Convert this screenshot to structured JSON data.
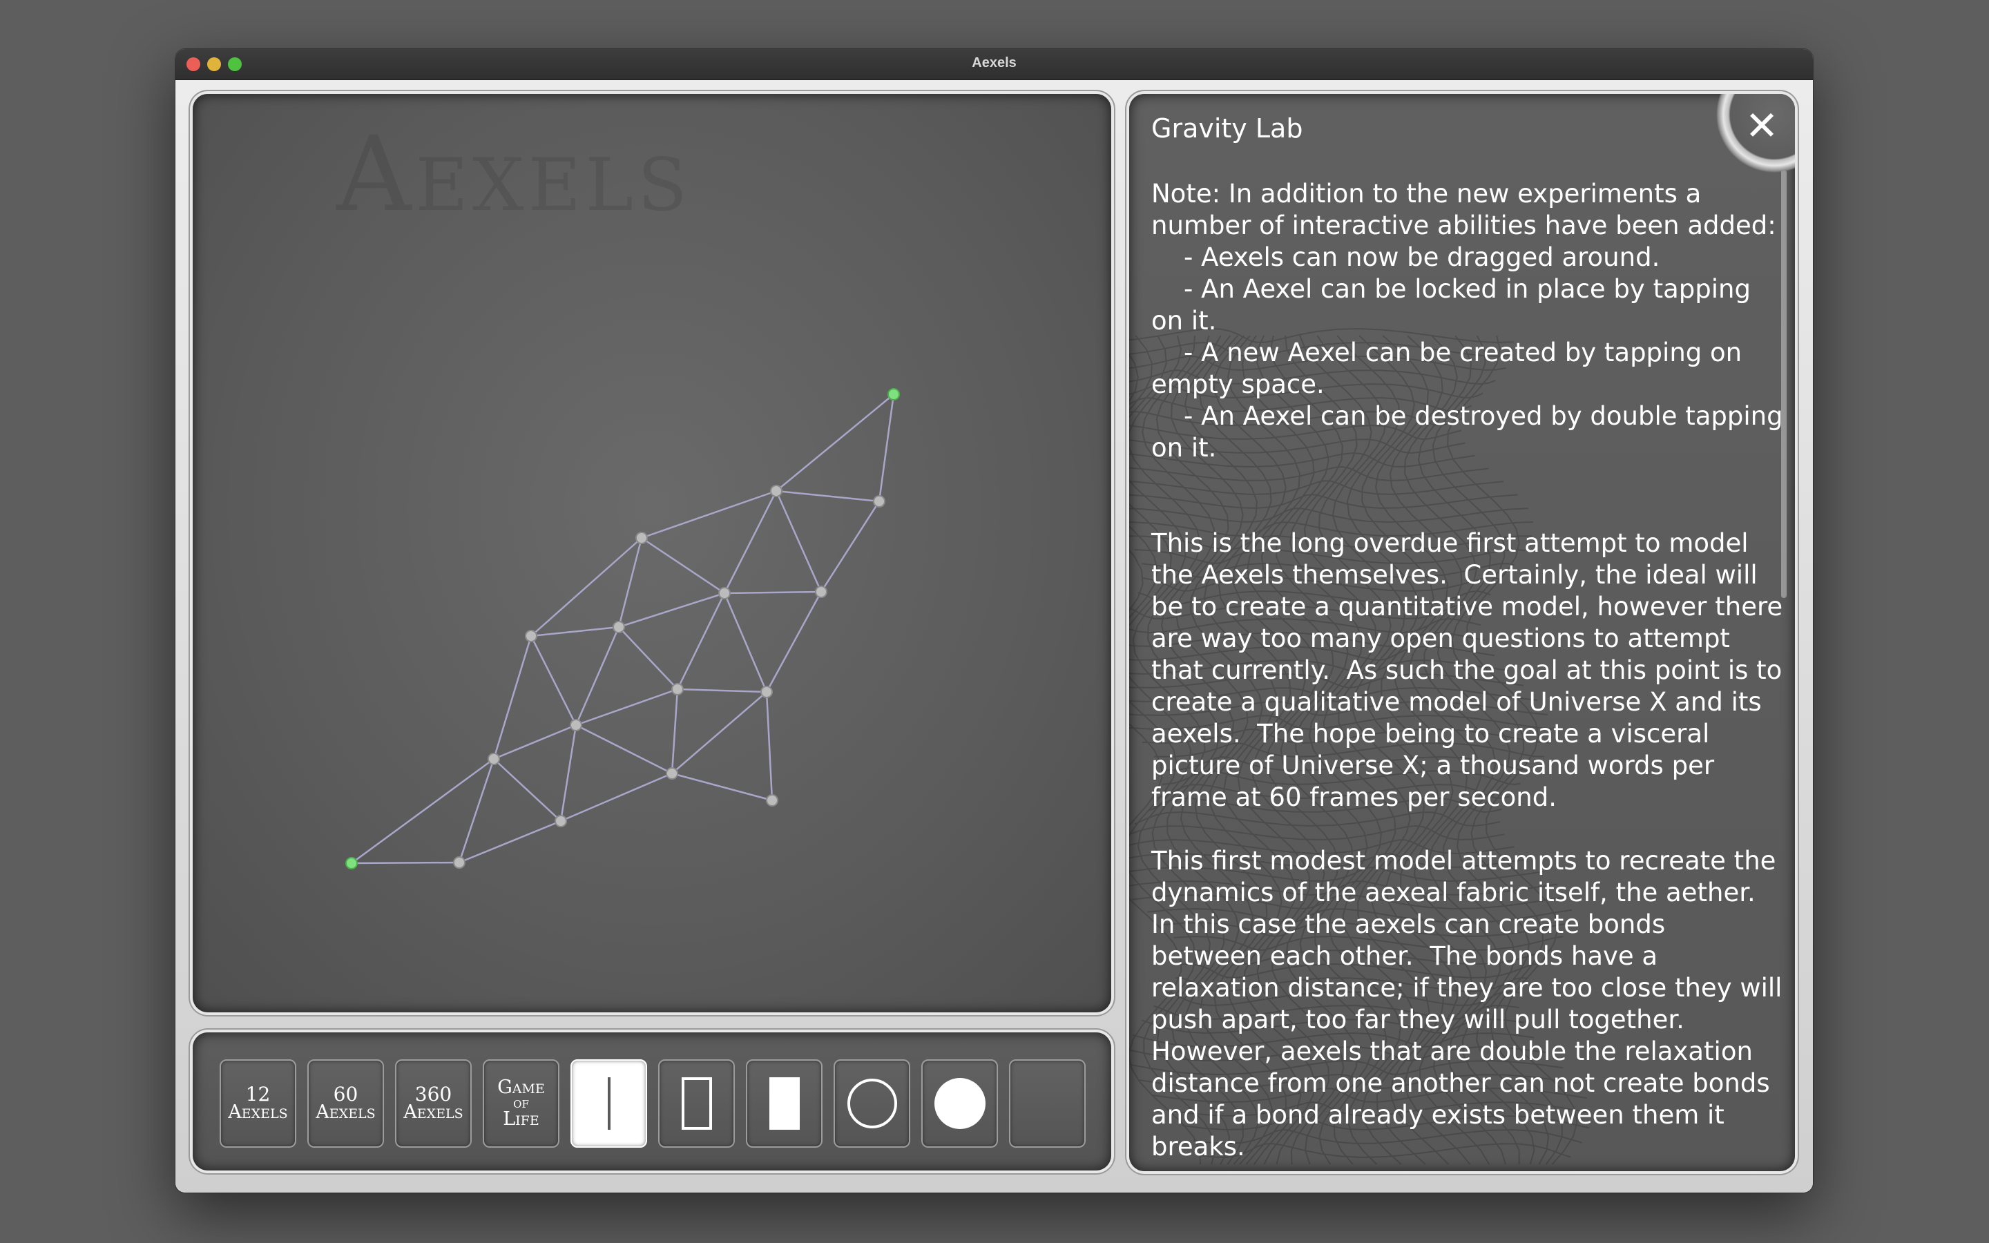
{
  "window": {
    "title": "Aexels"
  },
  "simulation": {
    "watermark": "Aexels",
    "colors": {
      "edge": "#a9a7c9",
      "node": "#bcbcbc",
      "locked_node": "#7ee07e"
    }
  },
  "toolbar": {
    "buttons": [
      {
        "line1": "12",
        "line2": "Aexels"
      },
      {
        "line1": "60",
        "line2": "Aexels"
      },
      {
        "line1": "360",
        "line2": "Aexels"
      },
      {
        "line1": "Game",
        "line2": "of",
        "line3": "Life"
      }
    ],
    "shape_buttons": [
      {
        "icon": "line-icon",
        "selected": true
      },
      {
        "icon": "outline-rectangle-icon",
        "selected": false
      },
      {
        "icon": "filled-rectangle-icon",
        "selected": false
      },
      {
        "icon": "outline-circle-icon",
        "selected": false
      },
      {
        "icon": "filled-circle-icon",
        "selected": false
      },
      {
        "icon": "empty-icon",
        "selected": false
      }
    ]
  },
  "info": {
    "title": "Gravity Lab",
    "close_icon": "close-icon",
    "body": "Note: In addition to the new experiments a number of interactive abilities have been added:\n    - Aexels can now be dragged around.\n    - An Aexel can be locked in place by tapping on it.\n    - A new Aexel can be created by tapping on empty space.\n    - An Aexel can be destroyed by double tapping on it.\n\n\nThis is the long overdue first attempt to model the Aexels themselves.  Certainly, the ideal will be to create a quantitative model, however there are way too many open questions to attempt that currently.  As such the goal at this point is to create a qualitative model of Universe X and its aexels.  The hope being to create a visceral picture of Universe X; a thousand words per frame at 60 frames per second.\n\nThis first modest model attempts to recreate the dynamics of the aexeal fabric itself, the aether.  In this case the aexels can create bonds between each other.  The bonds have a relaxation distance; if they are too close they will push apart, too far they will pull together.  However, aexels that are double the relaxation distance from one another can not create bonds and if a bond already exists between them it breaks."
  }
}
